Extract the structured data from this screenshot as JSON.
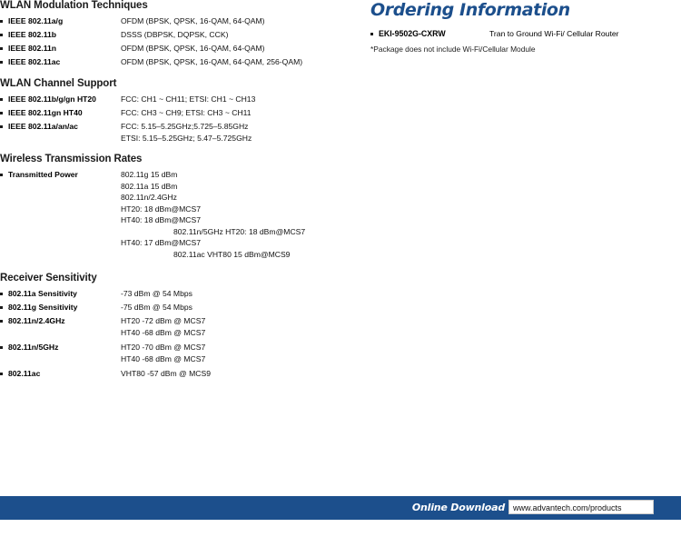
{
  "left": {
    "sections": [
      {
        "title": "WLAN Modulation Techniques",
        "rows": [
          {
            "label": "IEEE 802.11a/g",
            "value": "OFDM (BPSK, QPSK, 16-QAM, 64-QAM)"
          },
          {
            "label": "IEEE 802.11b",
            "value": "DSSS (DBPSK, DQPSK, CCK)"
          },
          {
            "label": "IEEE 802.11n",
            "value": "OFDM (BPSK, QPSK, 16-QAM, 64-QAM)"
          },
          {
            "label": "IEEE 802.11ac",
            "value": "OFDM (BPSK, QPSK, 16-QAM, 64-QAM, 256-QAM)"
          }
        ]
      },
      {
        "title": "WLAN Channel Support",
        "rows": [
          {
            "label": "IEEE 802.11b/g/gn HT20",
            "value": "FCC: CH1 ~ CH11; ETSI: CH1 ~ CH13"
          },
          {
            "label": "IEEE 802.11gn HT40",
            "value": "FCC: CH3 ~ CH9; ETSI: CH3 ~ CH11"
          },
          {
            "label": "IEEE 802.11a/an/ac",
            "value": "FCC: 5.15–5.25GHz;5.725–5.85GHz",
            "value2": "ETSI: 5.15–5.25GHz; 5.47–5.725GHz"
          }
        ]
      },
      {
        "title": "Wireless Transmission Rates",
        "rows": [
          {
            "label": "Transmitted Power",
            "lines": [
              {
                "text": "802.11g 15 dBm",
                "indent": false
              },
              {
                "text": "802.11a 15 dBm",
                "indent": false
              },
              {
                "text": "802.11n/2.4GHz",
                "indent": false
              },
              {
                "text": "HT20: 18 dBm@MCS7",
                "indent": false
              },
              {
                "text": "HT40: 18 dBm@MCS7",
                "indent": false
              },
              {
                "text": "802.11n/5GHz HT20: 18 dBm@MCS7",
                "indent": true
              },
              {
                "text": "HT40: 17 dBm@MCS7",
                "indent": false
              },
              {
                "text": "802.11ac VHT80 15 dBm@MCS9",
                "indent": true
              }
            ]
          }
        ]
      },
      {
        "title": "Receiver Sensitivity",
        "rows": [
          {
            "label": "802.11a Sensitivity",
            "value": "-73 dBm @ 54 Mbps"
          },
          {
            "label": "802.11g Sensitivity",
            "value": "-75 dBm @ 54 Mbps"
          },
          {
            "label": "802.11n/2.4GHz",
            "value": "HT20 -72 dBm @ MCS7",
            "value2": "HT40 -68 dBm @ MCS7"
          },
          {
            "label": "802.11n/5GHz",
            "value": "HT20 -70 dBm @ MCS7",
            "value2": "HT40 -68 dBm @ MCS7"
          },
          {
            "label": "802.11ac",
            "value": "VHT80 -57 dBm @ MCS9"
          }
        ]
      }
    ]
  },
  "right": {
    "title": "Ordering Information",
    "items": [
      {
        "model": "EKI-9502G-CXRW",
        "description": "Tran to Ground Wi-Fi/ Cellular Router"
      }
    ],
    "note": "*Package does not include Wi-Fi/Cellular Module"
  },
  "footer": {
    "online_download": "Online Download",
    "url": "www.advantech.com/products"
  },
  "colors": {
    "accent": "#1c4f8c",
    "text": "#111111"
  }
}
